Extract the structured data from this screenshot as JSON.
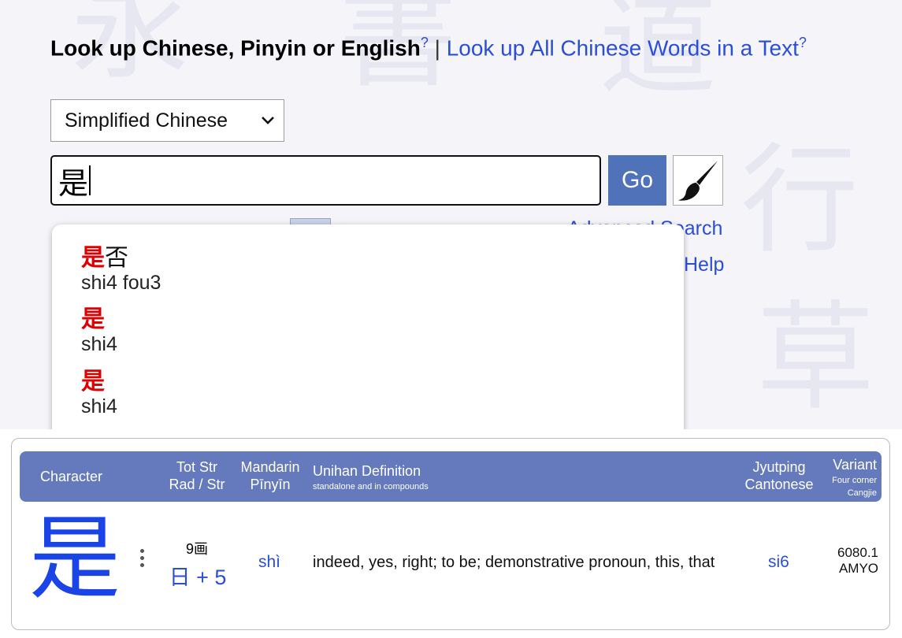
{
  "heading": {
    "lookup": "Look up Chinese, Pinyin or English",
    "help_mark": "?",
    "separator": "|",
    "all_words_link": "Look up All Chinese Words in a Text",
    "all_words_help_mark": "?"
  },
  "search": {
    "script_option": "Simplified Chinese",
    "query": "是",
    "go_label": "Go",
    "brush_icon": "brush-icon"
  },
  "links": {
    "advanced_search": "Advanced Search",
    "help": "Help"
  },
  "suggestions": [
    {
      "highlight": "是",
      "rest": "否",
      "pinyin": "shi4 fou3"
    },
    {
      "highlight": "是",
      "rest": "",
      "pinyin": "shi4"
    },
    {
      "highlight": "是",
      "rest": "",
      "pinyin": "shi4"
    }
  ],
  "result": {
    "headers": {
      "character": "Character",
      "tot_str": "Tot Str",
      "rad_str": "Rad / Str",
      "mandarin": "Mandarin",
      "pinyin": "Pīnyīn",
      "unihan": "Unihan Definition",
      "unihan_sub": "standalone and in compounds",
      "jyutping": "Jyutping",
      "cantonese": "Cantonese",
      "variant": "Variant",
      "four_corner": "Four corner",
      "cangjie": "Cangjie"
    },
    "row": {
      "character": "是",
      "total_strokes": "9画",
      "radical": "日 + 5",
      "pinyin": "shì",
      "definition": "indeed, yes, right; to be; demonstrative pronoun, this, that",
      "jyutping": "si6",
      "four_corner": "6080.1",
      "cangjie": "AMYO"
    }
  },
  "colors": {
    "link": "#2a4ed8",
    "header_bg": "#6579bd",
    "go_bg": "#5072b8",
    "highlight": "#e00000",
    "big_char": "#1a44e6"
  }
}
